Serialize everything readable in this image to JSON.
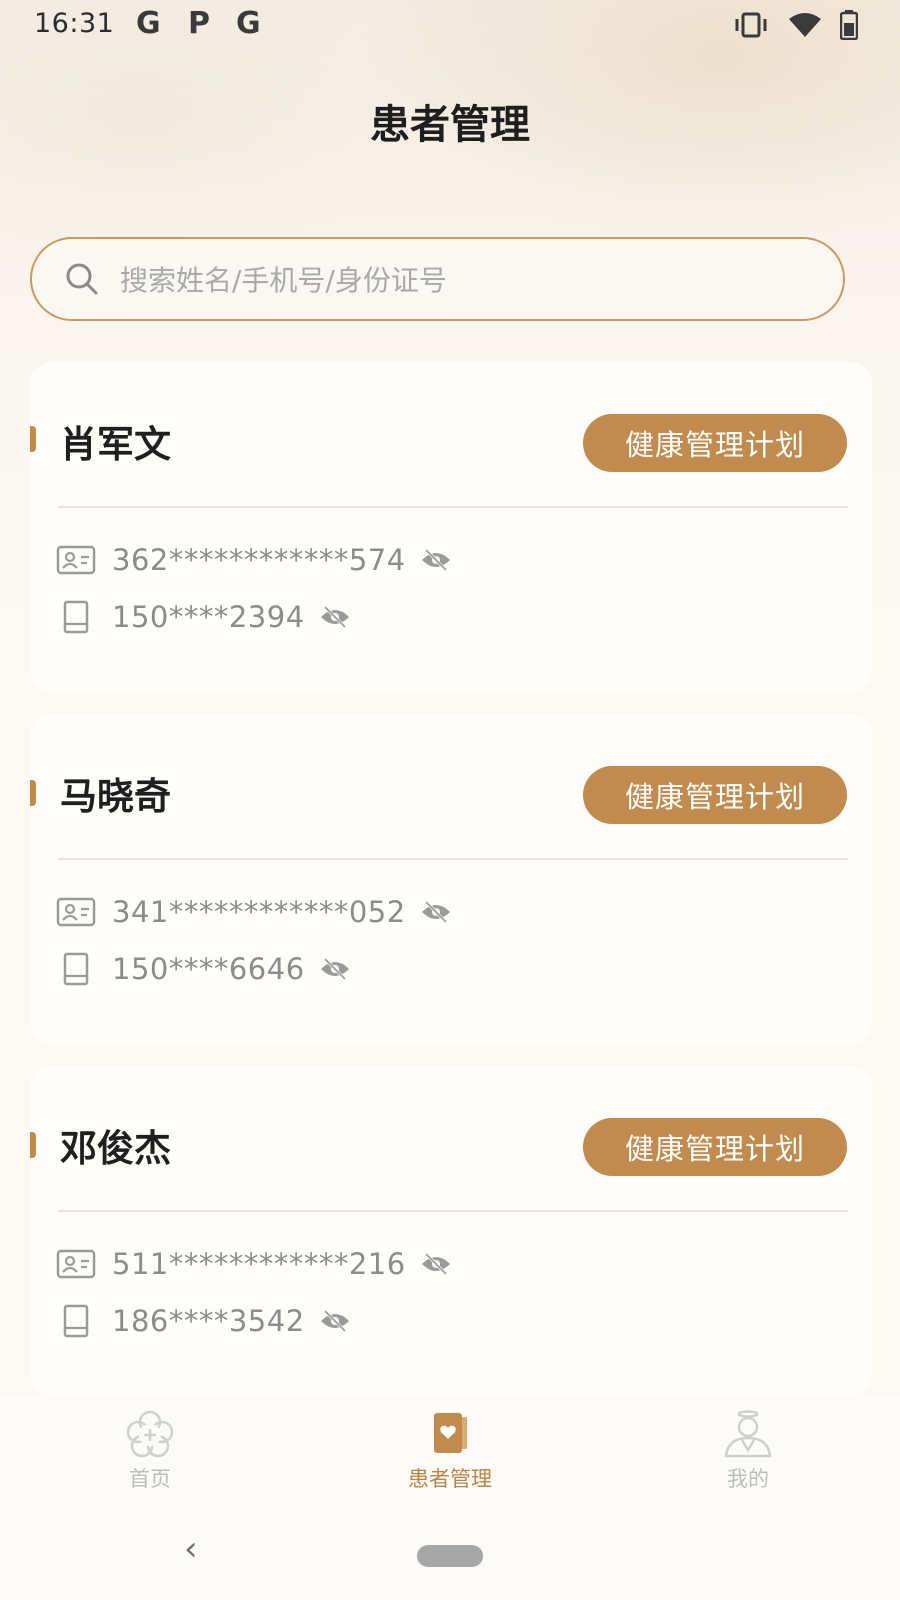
{
  "status_bar": {
    "time": "16:31",
    "notification_letters": [
      "G",
      "P",
      "G"
    ],
    "icons": [
      "vibrate-icon",
      "wifi-icon",
      "battery-icon"
    ]
  },
  "header": {
    "title": "患者管理"
  },
  "search": {
    "placeholder": "搜索姓名/手机号/身份证号",
    "icon": "search-icon"
  },
  "patients": [
    {
      "name": "肖军文",
      "plan_label": "健康管理计划",
      "id_number": "362************574",
      "phone": "150****2394"
    },
    {
      "name": "马晓奇",
      "plan_label": "健康管理计划",
      "id_number": "341************052",
      "phone": "150****6646"
    },
    {
      "name": "邓俊杰",
      "plan_label": "健康管理计划",
      "id_number": "511************216",
      "phone": "186****3542"
    }
  ],
  "tabbar": {
    "items": [
      {
        "label": "首页",
        "icon": "flower-home-icon",
        "active": false
      },
      {
        "label": "患者管理",
        "icon": "patient-book-icon",
        "active": true
      },
      {
        "label": "我的",
        "icon": "profile-icon",
        "active": false
      }
    ]
  },
  "navbar": {
    "back_glyph": "‹"
  },
  "colors": {
    "accent": "#c08b4c",
    "accent_text": "#b78547",
    "search_border": "#c99a5c",
    "muted_text": "#8c8c8c"
  }
}
